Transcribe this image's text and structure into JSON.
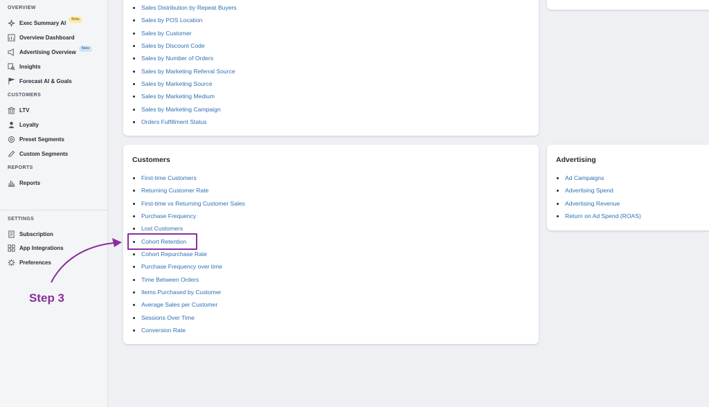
{
  "sidebar": {
    "sections": {
      "overview": "OVERVIEW",
      "customers": "CUSTOMERS",
      "reports": "REPORTS",
      "settings": "SETTINGS"
    },
    "items": [
      {
        "label": "Exec Summary AI",
        "icon": "sparkle-icon",
        "badge": "Beta"
      },
      {
        "label": "Overview Dashboard",
        "icon": "dashboard-icon"
      },
      {
        "label": "Advertising Overview",
        "icon": "megaphone-icon",
        "badge": "New"
      },
      {
        "label": "Insights",
        "icon": "insights-icon"
      },
      {
        "label": "Forecast AI & Goals",
        "icon": "flag-icon"
      },
      {
        "label": "LTV",
        "icon": "bank-icon"
      },
      {
        "label": "Loyalty",
        "icon": "person-icon"
      },
      {
        "label": "Preset Segments",
        "icon": "gear-segments-icon"
      },
      {
        "label": "Custom Segments",
        "icon": "pencil-icon"
      },
      {
        "label": "Reports",
        "icon": "bar-chart-icon"
      },
      {
        "label": "Subscription",
        "icon": "document-icon"
      },
      {
        "label": "App Integrations",
        "icon": "apps-icon"
      },
      {
        "label": "Preferences",
        "icon": "settings-icon"
      }
    ]
  },
  "sales_card": {
    "links": [
      "Sales Distribution by Repeat Buyers",
      "Sales by POS Location",
      "Sales by Customer",
      "Sales by Discount Code",
      "Sales by Number of Orders",
      "Sales by Marketing Referral Source",
      "Sales by Marketing Source",
      "Sales by Marketing Medium",
      "Sales by Marketing Campaign",
      "Orders Fulfillment Status"
    ]
  },
  "customers_card": {
    "title": "Customers",
    "links": [
      "First-time Customers",
      "Returning Customer Rate",
      "First-time vs Returning Customer Sales",
      "Purchase Frequency",
      "Lost Customers",
      "Cohort Retention",
      "Cohort Repurchase Rate",
      "Purchase Frequency over time",
      "Time Between Orders",
      "Items Purchased by Customer",
      "Average Sales per Customer",
      "Sessions Over Time",
      "Conversion Rate"
    ]
  },
  "advertising_card": {
    "title": "Advertising",
    "links": [
      "Ad Campaigns",
      "Advertising Spend",
      "Advertising Revenue",
      "Return on Ad Spend (ROAS)"
    ]
  },
  "annotation": {
    "step_label": "Step 3",
    "color": "#8a2d9c"
  },
  "colors": {
    "link": "#2f6fb5",
    "background": "#eef0f3",
    "sidebar": "#f4f5f7"
  }
}
